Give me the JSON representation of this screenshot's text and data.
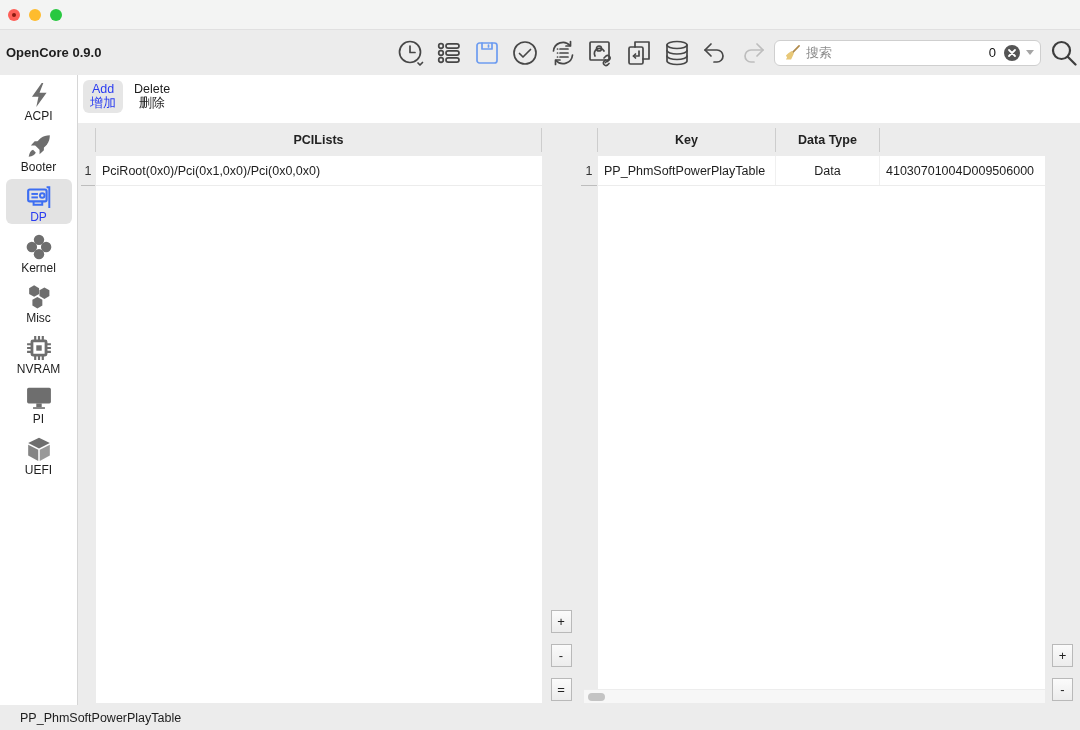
{
  "toolbar": {
    "title": "OpenCore 0.9.0",
    "tools": [
      {
        "kind": "history",
        "active": false,
        "disabled": false
      },
      {
        "kind": "list",
        "active": false,
        "disabled": false
      },
      {
        "kind": "save",
        "active": true,
        "disabled": false
      },
      {
        "kind": "check",
        "active": false,
        "disabled": false
      },
      {
        "kind": "refresh",
        "active": false,
        "disabled": false
      },
      {
        "kind": "image",
        "active": false,
        "disabled": false
      },
      {
        "kind": "copy",
        "active": false,
        "disabled": false
      },
      {
        "kind": "database",
        "active": false,
        "disabled": false
      },
      {
        "kind": "undo",
        "active": false,
        "disabled": false
      },
      {
        "kind": "redo",
        "active": false,
        "disabled": true
      }
    ],
    "search": {
      "placeholder": "搜索",
      "count": "0"
    }
  },
  "sidebar": {
    "items": [
      {
        "kind": "acpi",
        "label": "ACPI",
        "selected": false
      },
      {
        "kind": "booter",
        "label": "Booter",
        "selected": false
      },
      {
        "kind": "dp",
        "label": "DP",
        "selected": true
      },
      {
        "kind": "kernel",
        "label": "Kernel",
        "selected": false
      },
      {
        "kind": "misc",
        "label": "Misc",
        "selected": false
      },
      {
        "kind": "nvram",
        "label": "NVRAM",
        "selected": false
      },
      {
        "kind": "pi",
        "label": "PI",
        "selected": false
      },
      {
        "kind": "uefi",
        "label": "UEFI",
        "selected": false
      }
    ]
  },
  "tabs": [
    {
      "label": "Add",
      "label_translation": "增加",
      "selected": true
    },
    {
      "label": "Delete",
      "label_translation": "删除",
      "selected": false
    }
  ],
  "pci_table": {
    "columns": [
      "PCILists"
    ],
    "rows": [
      {
        "number": "1",
        "cells": [
          "PciRoot(0x0)/Pci(0x1,0x0)/Pci(0x0,0x0)"
        ]
      }
    ],
    "buttons": [
      "+",
      "-",
      "="
    ]
  },
  "property_table": {
    "columns": [
      "Key",
      "Data Type"
    ],
    "rows": [
      {
        "number": "1",
        "cells": [
          "PP_PhmSoftPowerPlayTable",
          "Data",
          "41030701004D009506000"
        ]
      }
    ],
    "buttons": [
      "+",
      "-"
    ]
  },
  "status_bar": {
    "text": "PP_PhmSoftPowerPlayTable"
  }
}
